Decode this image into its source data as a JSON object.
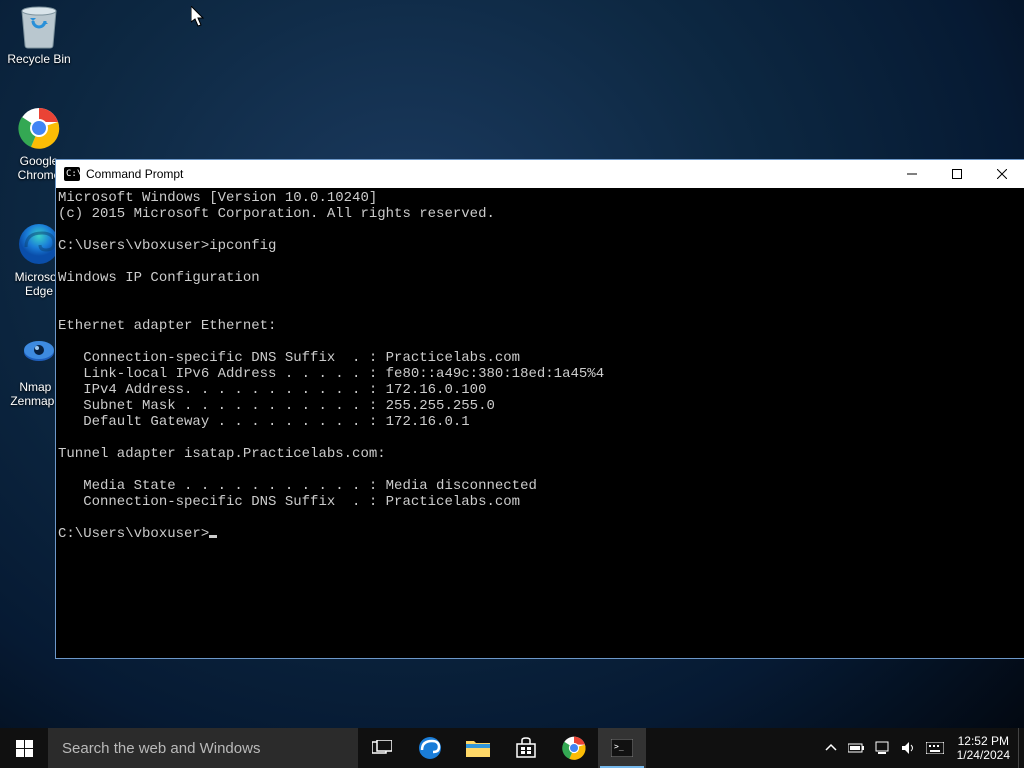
{
  "desktop": {
    "icons": [
      {
        "name": "recycle-bin",
        "label": "Recycle Bin"
      },
      {
        "name": "google-chrome",
        "label": "Google\nChrome"
      },
      {
        "name": "microsoft-edge",
        "label": "Microsoft\nEdge"
      },
      {
        "name": "nmap-zenmap",
        "label": "Nmap -\nZenmap ..."
      }
    ]
  },
  "cmd": {
    "title": "Command Prompt",
    "content": "Microsoft Windows [Version 10.0.10240]\n(c) 2015 Microsoft Corporation. All rights reserved.\n\nC:\\Users\\vboxuser>ipconfig\n\nWindows IP Configuration\n\n\nEthernet adapter Ethernet:\n\n   Connection-specific DNS Suffix  . : Practicelabs.com\n   Link-local IPv6 Address . . . . . : fe80::a49c:380:18ed:1a45%4\n   IPv4 Address. . . . . . . . . . . : 172.16.0.100\n   Subnet Mask . . . . . . . . . . . : 255.255.255.0\n   Default Gateway . . . . . . . . . : 172.16.0.1\n\nTunnel adapter isatap.Practicelabs.com:\n\n   Media State . . . . . . . . . . . : Media disconnected\n   Connection-specific DNS Suffix  . : Practicelabs.com\n\nC:\\Users\\vboxuser>"
  },
  "taskbar": {
    "search_placeholder": "Search the web and Windows",
    "clock": {
      "time": "12:52 PM",
      "date": "1/24/2024"
    }
  }
}
